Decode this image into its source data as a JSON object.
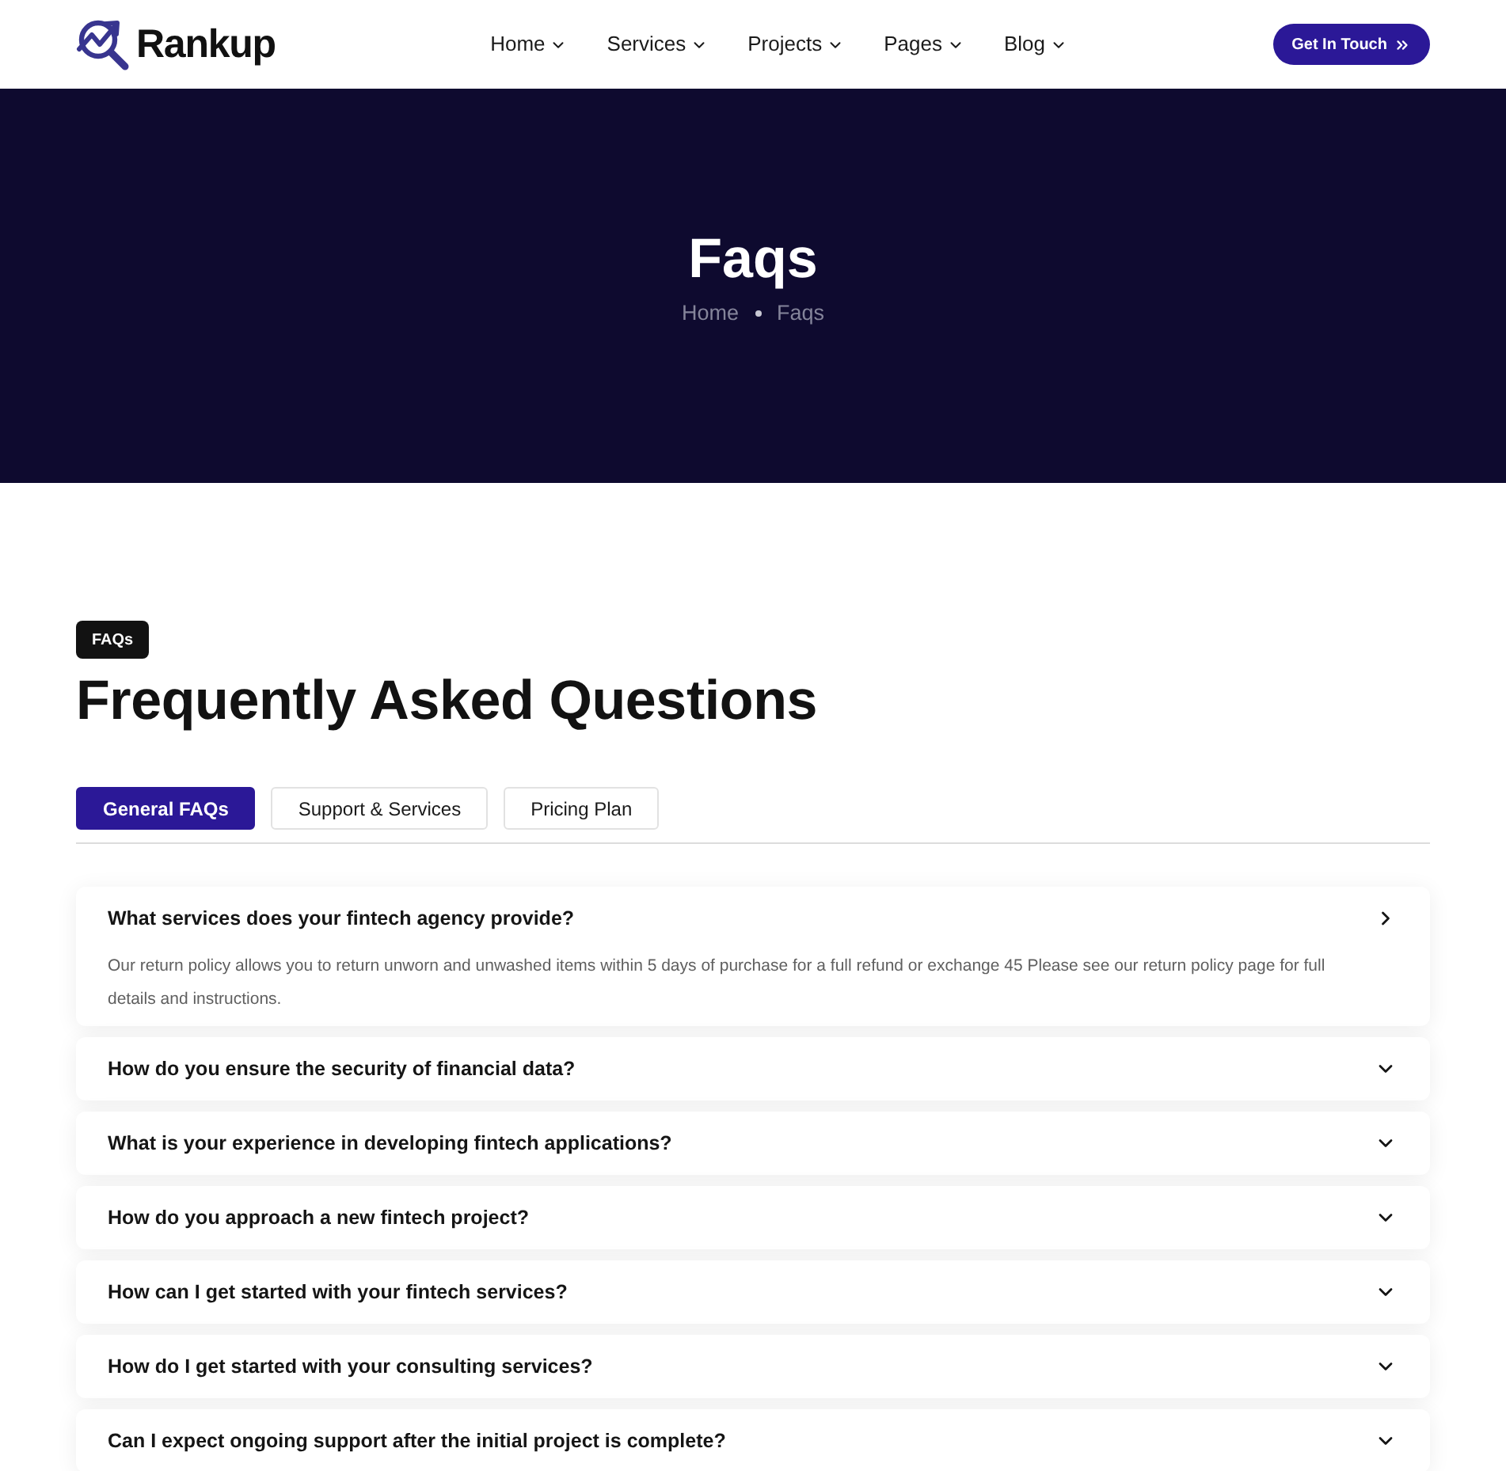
{
  "header": {
    "logo": {
      "text": "Rankup"
    },
    "nav": [
      {
        "label": "Home"
      },
      {
        "label": "Services"
      },
      {
        "label": "Projects"
      },
      {
        "label": "Pages"
      },
      {
        "label": "Blog"
      }
    ],
    "cta": {
      "label": "Get In Touch"
    }
  },
  "hero": {
    "title": "Faqs",
    "breadcrumb": [
      "Home",
      "Faqs"
    ]
  },
  "section": {
    "badge": "FAQs",
    "heading": "Frequently Asked Questions",
    "tabs": [
      {
        "label": "General FAQs",
        "selected": true
      },
      {
        "label": "Support & Services",
        "selected": false
      },
      {
        "label": "Pricing Plan",
        "selected": false
      }
    ],
    "faqs": [
      {
        "question": "What services does your fintech agency provide?",
        "expanded": true,
        "answer": "Our return policy allows you to return unworn and unwashed items within 5 days of purchase for a full refund or exchange 45 Please see our return policy page for full details and instructions."
      },
      {
        "question": "How do you ensure the security of financial data?",
        "expanded": false
      },
      {
        "question": "What is your experience in developing fintech applications?",
        "expanded": false
      },
      {
        "question": "How do you approach a new fintech project?",
        "expanded": false
      },
      {
        "question": "How can I get started with your fintech services?",
        "expanded": false
      },
      {
        "question": "How do I get started with your consulting services?",
        "expanded": false
      },
      {
        "question": "Can I expect ongoing support after the initial project is complete?",
        "expanded": false
      }
    ]
  }
}
